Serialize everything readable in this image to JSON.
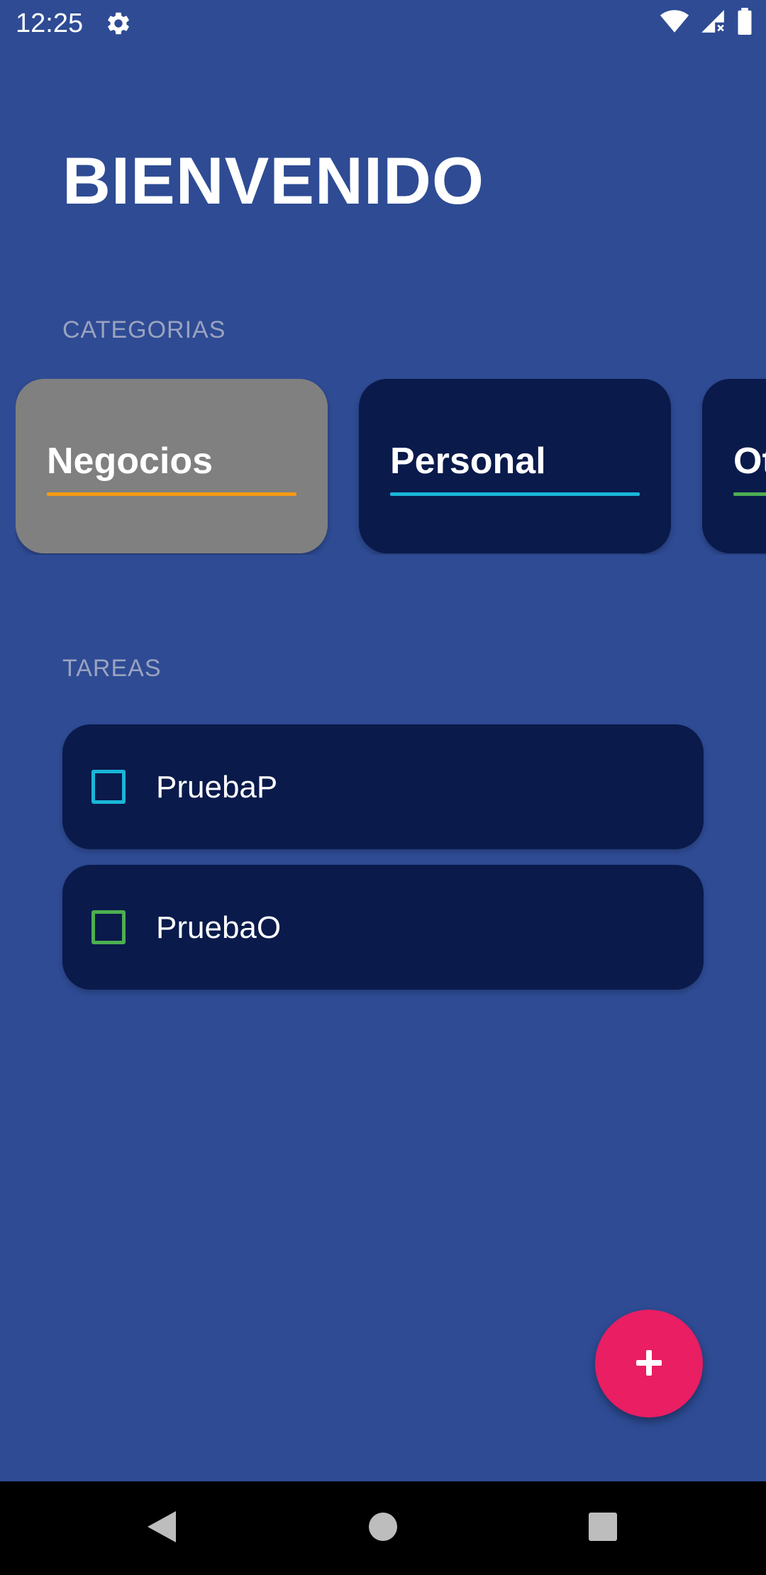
{
  "status_bar": {
    "time": "12:25",
    "icons": [
      "gear-icon",
      "wifi-icon",
      "signal-icon",
      "battery-icon"
    ]
  },
  "header": {
    "title": "BIENVENIDO"
  },
  "categories": {
    "label": "CATEGORIAS",
    "items": [
      {
        "name": "Negocios",
        "color": "#f59a14",
        "selected": true
      },
      {
        "name": "Personal",
        "color": "#1ab6d8",
        "selected": false
      },
      {
        "name": "Ot",
        "color": "#4caf50",
        "selected": false
      }
    ]
  },
  "tasks": {
    "label": "TAREAS",
    "items": [
      {
        "name": "PruebaP",
        "checked": false,
        "color": "#1ab6d8"
      },
      {
        "name": "PruebaO",
        "checked": false,
        "color": "#4caf50"
      }
    ]
  },
  "fab": {
    "icon": "plus-icon",
    "color": "#e91e63"
  },
  "nav_bar": {
    "icons": [
      "back-icon",
      "home-icon",
      "recents-icon"
    ]
  },
  "colors": {
    "background": "#2e4b94",
    "card": "#0a1a4b",
    "selected_card": "#808080"
  }
}
